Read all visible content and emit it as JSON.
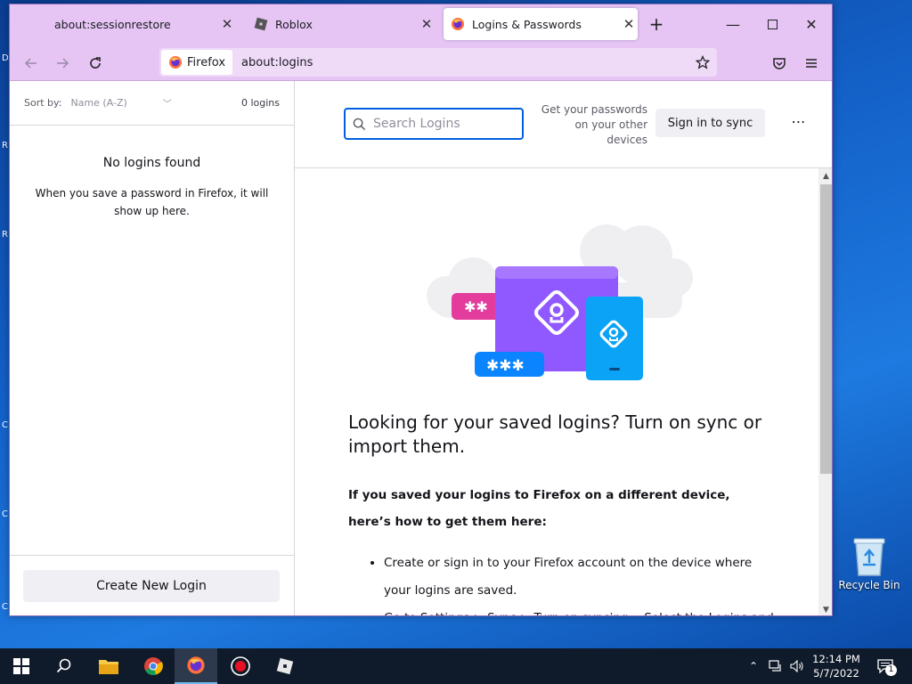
{
  "tabs": [
    {
      "label": "about:sessionrestore"
    },
    {
      "label": "Roblox"
    },
    {
      "label": "Logins & Passwords"
    }
  ],
  "navbar": {
    "identity_label": "Firefox",
    "url": "about:logins"
  },
  "sidebar": {
    "sort_label": "Sort by:",
    "sort_value": "Name (A-Z)",
    "login_count": "0 logins",
    "empty_title": "No logins found",
    "empty_desc": "When you save a password in Firefox, it will show up here.",
    "create_button": "Create New Login"
  },
  "main": {
    "search_placeholder": "Search Logins",
    "sync_text": "Get your passwords on your other devices",
    "sync_button": "Sign in to sync",
    "more_label": "⋯",
    "intro_title": "Looking for your saved logins? Turn on sync or import them.",
    "intro_sub": "If you saved your logins to Firefox on a different device, here’s how to get them here:",
    "steps": [
      "Create or sign in to your Firefox account on the device where your logins are saved.",
      "Go to Settings > Sync > Turn on syncing… Select the Logins and"
    ]
  },
  "illustration": {
    "dots_small": "✱✱",
    "dots_large": "✱✱✱"
  },
  "desktop": {
    "recycle_bin_label": "Recycle Bin",
    "edge_fragments": [
      "D",
      "R",
      "R",
      "C",
      "C",
      "C"
    ]
  },
  "taskbar": {
    "items": [
      "windows-start",
      "search",
      "file-explorer",
      "chrome",
      "firefox",
      "recorder",
      "roblox"
    ],
    "time": "12:14 PM",
    "date": "5/7/2022",
    "notification_count": "1"
  },
  "colors": {
    "tabbar_bg": "#e6c5f5",
    "accent": "#0060df",
    "purple_card": "#9059ff",
    "blue_card": "#0aa3f5"
  }
}
